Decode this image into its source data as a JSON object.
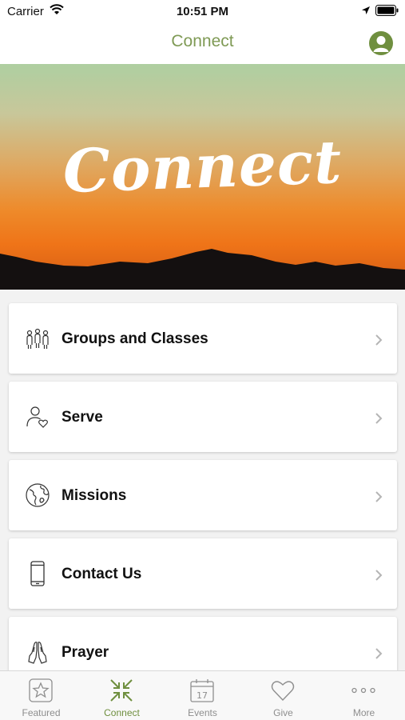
{
  "status_bar": {
    "carrier": "Carrier",
    "time": "10:51 PM"
  },
  "nav": {
    "title": "Connect",
    "profile_icon": "person-circle-icon"
  },
  "hero": {
    "text": "Connect"
  },
  "menu": {
    "items": [
      {
        "label": "Groups and Classes",
        "icon": "people-group-icon"
      },
      {
        "label": "Serve",
        "icon": "person-heart-icon"
      },
      {
        "label": "Missions",
        "icon": "globe-icon"
      },
      {
        "label": "Contact Us",
        "icon": "phone-icon"
      },
      {
        "label": "Prayer",
        "icon": "praying-hands-icon"
      }
    ]
  },
  "tabs": [
    {
      "label": "Featured",
      "icon": "star-icon",
      "active": false
    },
    {
      "label": "Connect",
      "icon": "connect-arrows-icon",
      "active": true
    },
    {
      "label": "Events",
      "icon": "calendar-icon",
      "active": false,
      "calendar_day": "17"
    },
    {
      "label": "Give",
      "icon": "heart-icon",
      "active": false
    },
    {
      "label": "More",
      "icon": "more-dots-icon",
      "active": false
    }
  ],
  "colors": {
    "accent": "#6f8f3f",
    "title": "#7f9a55",
    "tab_inactive": "#8e8e8e"
  }
}
